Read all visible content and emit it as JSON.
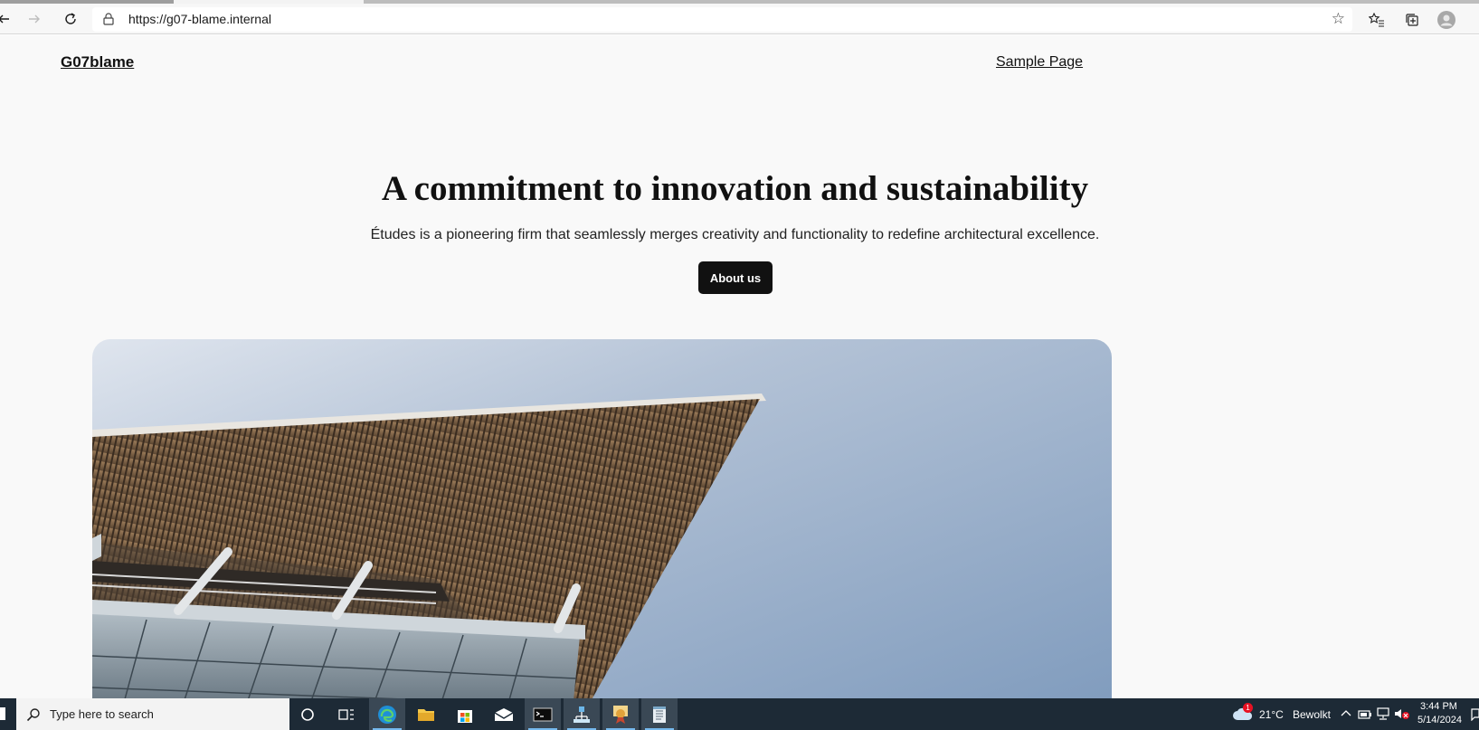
{
  "browser": {
    "url": "https://g07-blame.internal",
    "icons": [
      "back-arrow-icon",
      "forward-arrow-icon",
      "refresh-icon",
      "lock-icon",
      "star-icon",
      "favorites-icon",
      "collections-icon",
      "profile-icon"
    ]
  },
  "site": {
    "title": "G07blame",
    "nav_link": "Sample Page"
  },
  "hero": {
    "heading": "A commitment to innovation and sustainability",
    "text": "Études is a pioneering firm that seamlessly merges creativity and functionality to redefine architectural excellence.",
    "button_label": "About us",
    "image_subject": "modern building canopy against blue sky"
  },
  "taskbar": {
    "search_placeholder": "Type here to search",
    "apps": [
      "cortana-icon",
      "task-view-icon",
      "edge-icon",
      "file-explorer-icon",
      "store-icon",
      "mail-icon",
      "terminal-icon",
      "network-app-icon",
      "certificate-app-icon",
      "notepad-icon"
    ],
    "weather_temp": "21°C",
    "weather_desc": "Bewolkt",
    "weather_badge": "1",
    "time": "3:44 PM",
    "date": "5/14/2024"
  },
  "colors": {
    "page_bg": "#f9f9f9",
    "button_bg": "#111111",
    "taskbar_bg": "#1d2a36"
  }
}
